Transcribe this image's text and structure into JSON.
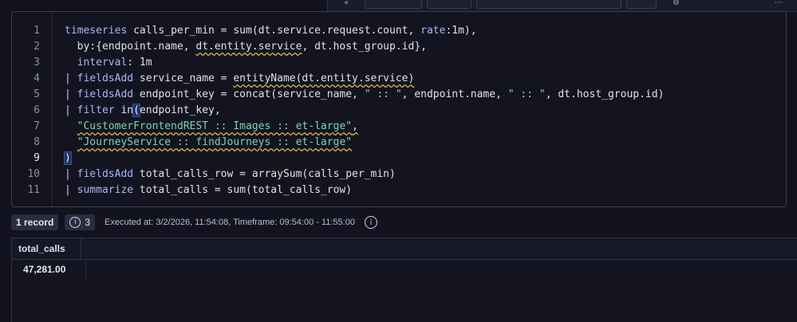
{
  "editor": {
    "line_numbers": [
      "1",
      "2",
      "3",
      "4",
      "5",
      "6",
      "7",
      "8",
      "9",
      "10",
      "11"
    ]
  },
  "code": {
    "l1_kw": "timeseries",
    "l1_a": " calls_per_min = sum(dt.service.request.count, ",
    "l1_param": "rate",
    "l1_b": ":1m),",
    "l2_a": "  by:{endpoint.name, ",
    "l2_sq": "dt.entity.service",
    "l2_b": ", dt.host_group.id},",
    "l3_param": "  interval",
    "l3_b": ": 1m",
    "l4_pipe": "| ",
    "l4_kw": "fieldsAdd",
    "l4_a": " service_name = ",
    "l4_sq": "entityName(dt.entity.service)",
    "l5_pipe": "| ",
    "l5_kw": "fieldsAdd",
    "l5_a": " endpoint_key = concat(service_name, ",
    "l5_s1": "\" :: \"",
    "l5_b": ", endpoint.name, ",
    "l5_s2": "\" :: \"",
    "l5_c": ", dt.host_group.id)",
    "l6_pipe": "| ",
    "l6_kw": "filter",
    "l6_a": " in",
    "l6_paren": "(",
    "l6_b": "endpoint_key,",
    "l7_indent": "  ",
    "l7_str": "\"CustomerFrontendREST :: Images :: et-large\"",
    "l7_b": ",",
    "l8_indent": "  ",
    "l8_str": "\"JourneyService :: findJourneys :: et-large\"",
    "l9_paren": ")",
    "l10_pipe": "| ",
    "l10_kw": "fieldsAdd",
    "l10_a": " total_calls_row = arraySum(calls_per_min)",
    "l11_pipe": "| ",
    "l11_kw": "summarize",
    "l11_a": " total_calls = sum(total_calls_row)"
  },
  "status": {
    "records": "1 record",
    "warnings_count": "3",
    "executed": "Executed at: 3/2/2026, 11:54:08, Timeframe: 09:54:00 - 11:55:00"
  },
  "table": {
    "columns": [
      "total_calls"
    ],
    "rows": [
      [
        "47,281.00"
      ]
    ]
  },
  "icons": {
    "warnings": "info-icon",
    "execution_info": "info-icon"
  }
}
